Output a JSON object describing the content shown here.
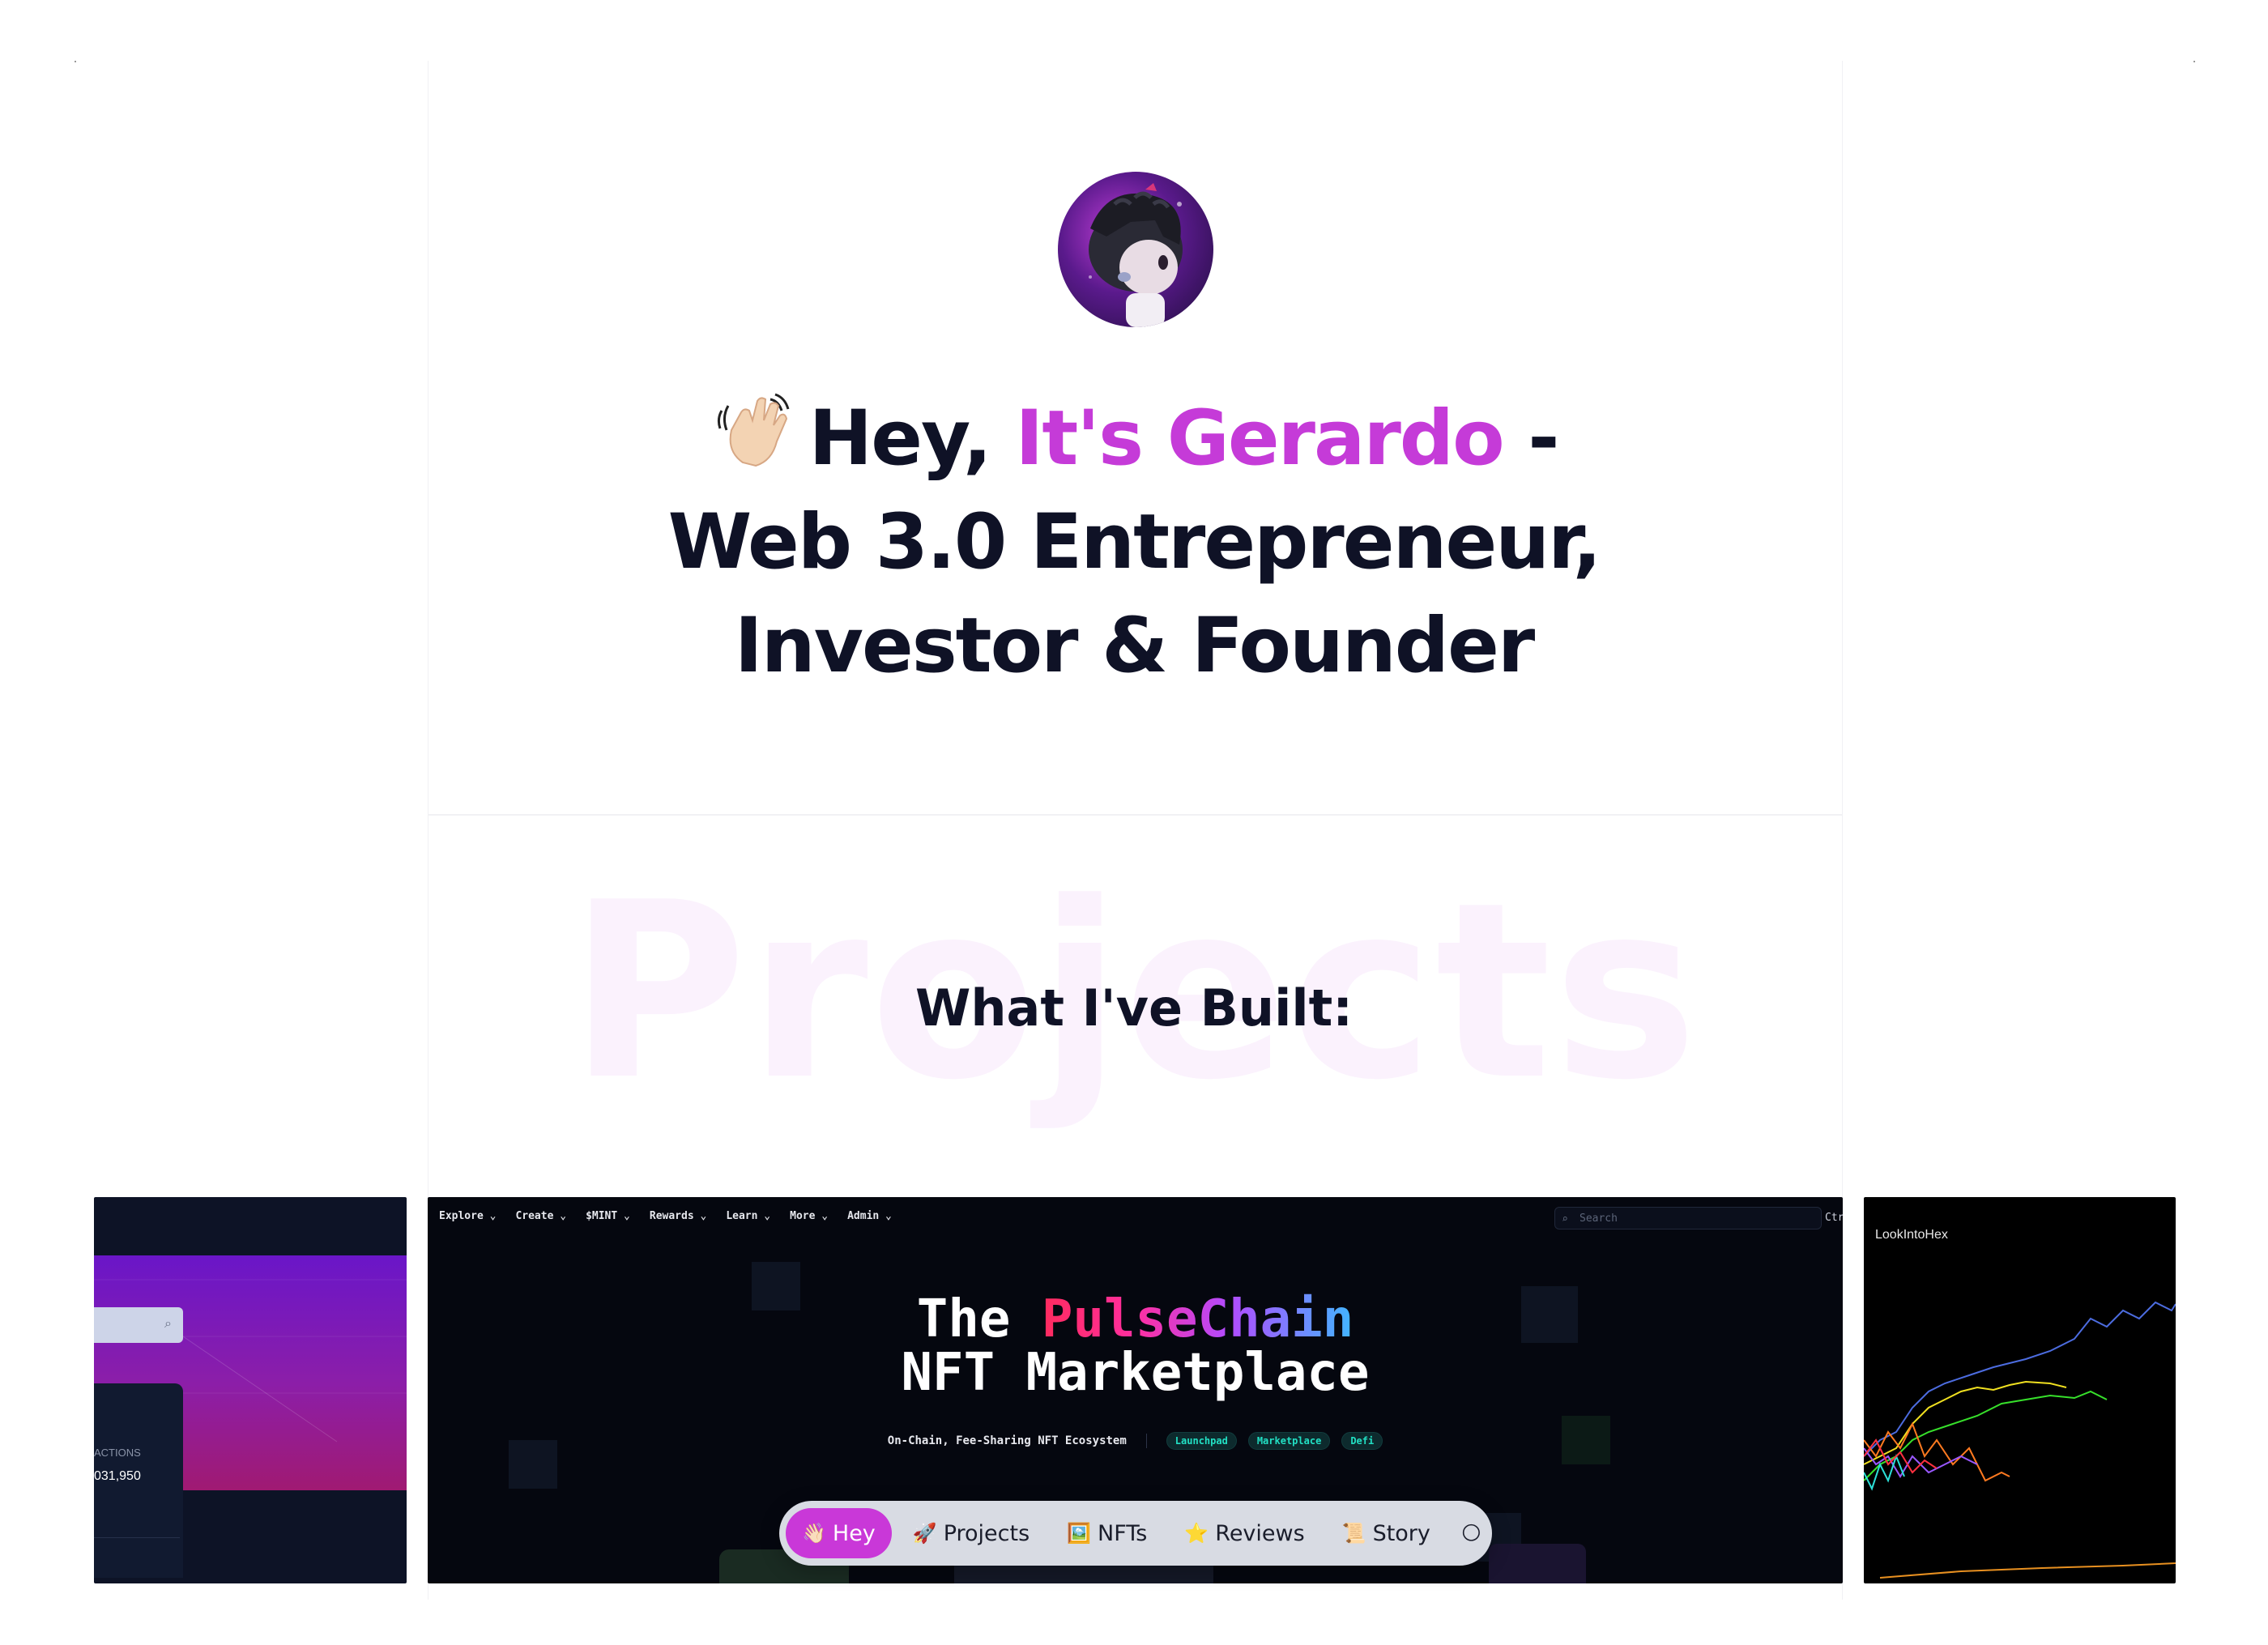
{
  "hero": {
    "avatar_alt": "",
    "wave_icon": "waving-hand-icon",
    "title_greeting": "Hey, ",
    "title_name": "It's Gerardo",
    "title_dash": " -",
    "title_line2": "Web 3.0 Entrepreneur,",
    "title_line3": "Investor & Founder"
  },
  "projects": {
    "watermark": "Projects",
    "heading": "What I've Built:"
  },
  "cards": {
    "left": {
      "label": "ACTIONS",
      "value": "031,950"
    },
    "main": {
      "nav": [
        "Explore ⌄",
        "Create ⌄",
        "$MINT ⌄",
        "Rewards ⌄",
        "Learn ⌄",
        "More ⌄",
        "Admin ⌄"
      ],
      "search_placeholder": "Search",
      "kbd": "Ctrl",
      "headline_the": "The ",
      "headline_pulse": "PulseChain",
      "headline_line2": "NFT Marketplace",
      "tagline": "On-Chain, Fee-Sharing NFT Ecosystem",
      "pills": [
        "Launchpad",
        "Marketplace",
        "Defi"
      ]
    },
    "right": {
      "title": "LookIntoHex"
    }
  },
  "dock": {
    "items": [
      {
        "icon": "👋🏻",
        "label": "Hey"
      },
      {
        "icon": "🚀",
        "label": "Projects"
      },
      {
        "icon": "🖼️",
        "label": "NFTs"
      },
      {
        "icon": "⭐",
        "label": "Reviews"
      },
      {
        "icon": "📜",
        "label": "Story"
      }
    ],
    "toggle_icon": "🌕"
  },
  "colors": {
    "accent": "#c53bd8",
    "text": "#0f1226",
    "watermark": "#fbf2fd"
  }
}
